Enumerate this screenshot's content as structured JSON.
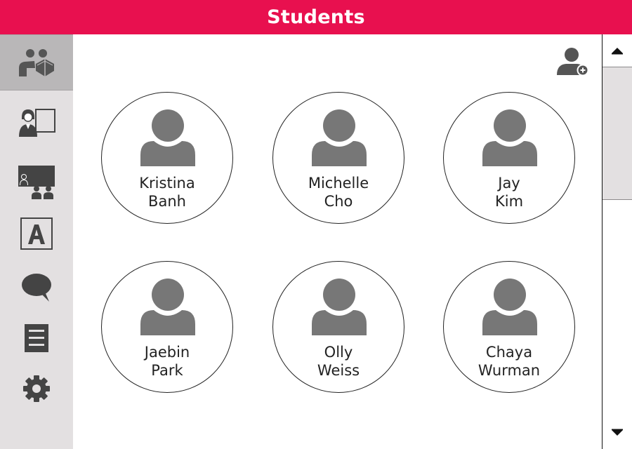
{
  "header": {
    "title": "Students"
  },
  "sidebar": {
    "items": [
      {
        "name": "students",
        "icon": "students-reading-icon",
        "active": true
      },
      {
        "name": "teacher",
        "icon": "teacher-board-icon",
        "active": false
      },
      {
        "name": "classroom",
        "icon": "classroom-icon",
        "active": false
      },
      {
        "name": "text",
        "icon": "letter-a-icon",
        "active": false
      },
      {
        "name": "chat",
        "icon": "speech-bubble-icon",
        "active": false
      },
      {
        "name": "list",
        "icon": "list-icon",
        "active": false
      },
      {
        "name": "settings",
        "icon": "gear-icon",
        "active": false
      }
    ]
  },
  "toolbar": {
    "add_student_icon": "add-user-icon"
  },
  "students": [
    {
      "first": "Kristina",
      "last": "Banh"
    },
    {
      "first": "Michelle",
      "last": "Cho"
    },
    {
      "first": "Jay",
      "last": "Kim"
    },
    {
      "first": "Jaebin",
      "last": "Park"
    },
    {
      "first": "Olly",
      "last": "Weiss"
    },
    {
      "first": "Chaya",
      "last": "Wurman"
    }
  ],
  "colors": {
    "accent": "#e8104f",
    "sidebar": "#e3e0e1",
    "sidebar_active": "#b9b7b8",
    "icon": "#6b6b6b"
  }
}
